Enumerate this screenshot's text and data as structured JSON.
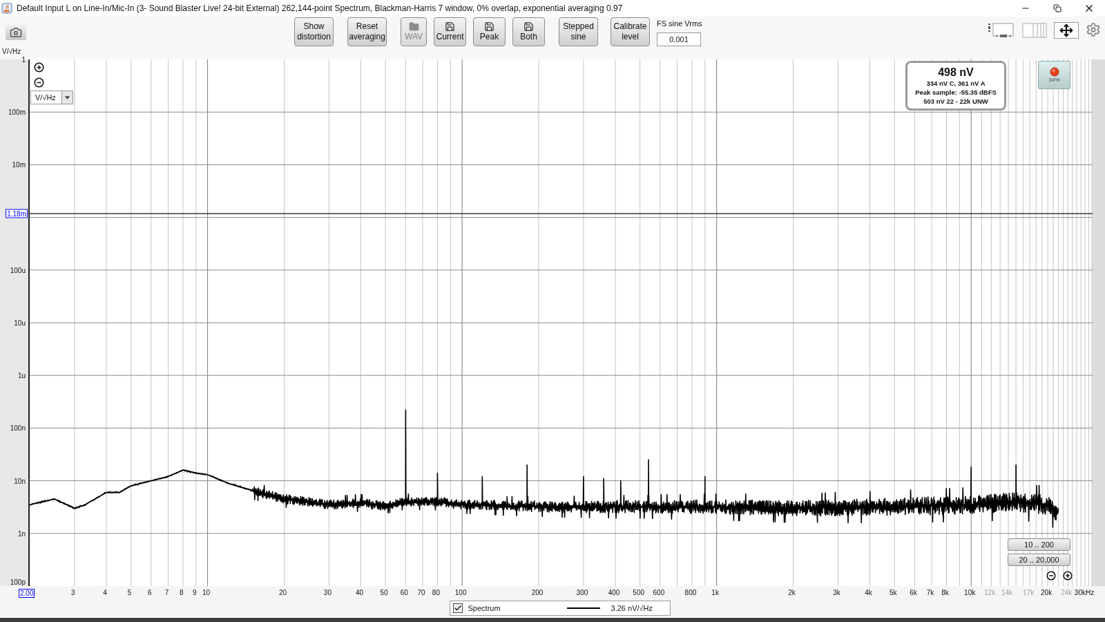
{
  "window": {
    "title": "Default Input L on Line-In/Mic-In (3- Sound Blaster Live! 24-bit External) 262,144-point Spectrum, Blackman-Harris 7 window, 0% overlap, exponential averaging 0.97"
  },
  "toolbar": {
    "buttons": [
      {
        "kind": "text",
        "label": "Show distortion",
        "disabled": false
      },
      {
        "kind": "text",
        "label": "Reset averaging",
        "disabled": false
      },
      {
        "kind": "folder",
        "label": "WAV",
        "disabled": true
      },
      {
        "kind": "save",
        "label": "Current",
        "disabled": false
      },
      {
        "kind": "save",
        "label": "Peak",
        "disabled": false
      },
      {
        "kind": "save",
        "label": "Both",
        "disabled": false
      },
      {
        "kind": "text",
        "label": "Stepped sine",
        "disabled": false
      },
      {
        "kind": "text",
        "label": "Calibrate level",
        "disabled": false
      }
    ],
    "fs_sine": {
      "label": "FS sine Vrms",
      "value": "0.001"
    }
  },
  "plot": {
    "unit_select": {
      "value": "V/√Hz"
    },
    "readout": {
      "main": "498 nV",
      "lines": [
        "334 nV C, 361 nV A",
        "Peak sample: -55.35 dBFS",
        "503 nV 22 - 22k UNW"
      ]
    },
    "record_indicator": {
      "reading": "34%"
    },
    "range_buttons": [
      "10 .. 200",
      "20 .. 20,000"
    ],
    "y_axis": {
      "unit": "V/√Hz",
      "cursor_field": "1.18m",
      "labels": [
        "1",
        "100m",
        "10m",
        "100u",
        "10u",
        "1u",
        "100n",
        "10n",
        "1n",
        "100p"
      ]
    },
    "x_axis": {
      "start_field": "2.00",
      "labels": [
        {
          "label": "3",
          "disabled": false
        },
        {
          "label": "4",
          "disabled": false
        },
        {
          "label": "5",
          "disabled": false
        },
        {
          "label": "6",
          "disabled": false
        },
        {
          "label": "7",
          "disabled": false
        },
        {
          "label": "8",
          "disabled": false
        },
        {
          "label": "9",
          "disabled": false
        },
        {
          "label": "10",
          "disabled": false
        },
        {
          "label": "20",
          "disabled": false
        },
        {
          "label": "30",
          "disabled": false
        },
        {
          "label": "40",
          "disabled": false
        },
        {
          "label": "50",
          "disabled": false
        },
        {
          "label": "60",
          "disabled": false
        },
        {
          "label": "70",
          "disabled": false
        },
        {
          "label": "80",
          "disabled": false
        },
        {
          "label": "100",
          "disabled": false
        },
        {
          "label": "200",
          "disabled": false
        },
        {
          "label": "300",
          "disabled": false
        },
        {
          "label": "400",
          "disabled": false
        },
        {
          "label": "500",
          "disabled": false
        },
        {
          "label": "600",
          "disabled": false
        },
        {
          "label": "800",
          "disabled": false
        },
        {
          "label": "1k",
          "disabled": false
        },
        {
          "label": "2k",
          "disabled": false
        },
        {
          "label": "3k",
          "disabled": false
        },
        {
          "label": "4k",
          "disabled": false
        },
        {
          "label": "5k",
          "disabled": false
        },
        {
          "label": "6k",
          "disabled": false
        },
        {
          "label": "7k",
          "disabled": false
        },
        {
          "label": "8k",
          "disabled": false
        },
        {
          "label": "10k",
          "disabled": false
        },
        {
          "label": "12k",
          "disabled": true
        },
        {
          "label": "14k",
          "disabled": true
        },
        {
          "label": "17k",
          "disabled": true
        },
        {
          "label": "20k",
          "disabled": false
        },
        {
          "label": "24k",
          "disabled": true
        },
        {
          "label": "30kHz",
          "disabled": false
        }
      ]
    }
  },
  "legend": {
    "label": "Spectrum",
    "checked": true,
    "reading": "3.26 nV/√Hz"
  }
}
